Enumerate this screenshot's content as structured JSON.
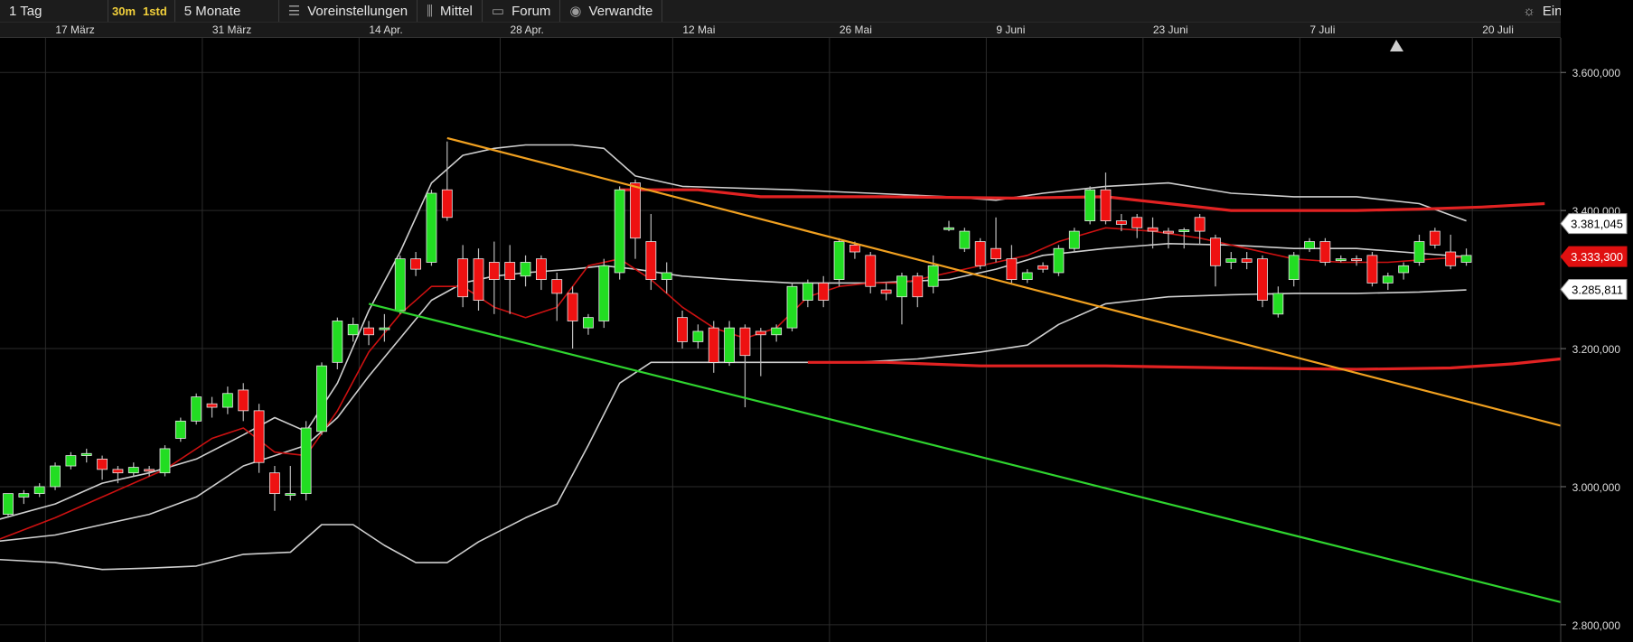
{
  "toolbar": {
    "period": "1 Tag",
    "interval_30m": "30m",
    "interval_1std": "1std",
    "range": "5 Monate",
    "presets": "Voreinstellungen",
    "indicator": "Mittel",
    "forum": "Forum",
    "related": "Verwandte",
    "settings": "Einstellungen"
  },
  "icons": {
    "presets": "sliders-icon",
    "indicator": "candlestick-icon",
    "forum": "speech-bubble-icon",
    "related": "eye-icon",
    "settings": "sun-gear-icon"
  },
  "chart_data": {
    "type": "candlestick",
    "x_axis": {
      "labels": [
        "17 März",
        "31 März",
        "14 Apr.",
        "28 Apr.",
        "12 Mai",
        "26 Mai",
        "9 Juni",
        "23 Juni",
        "7 Juli",
        "20 Juli"
      ],
      "label_index": [
        1,
        11,
        21,
        30,
        41,
        51,
        61,
        71,
        81,
        92
      ]
    },
    "y_axis": {
      "range": [
        2775000,
        3650000
      ],
      "ticks": [
        2800000,
        3000000,
        3200000,
        3400000,
        3600000
      ],
      "tick_labels": [
        "2.800,000",
        "3.000,000",
        "3.200,000",
        "3.400,000",
        "3.600,000"
      ]
    },
    "price_labels": [
      {
        "value": 3381045,
        "text": "3.381,045",
        "style": "white"
      },
      {
        "value": 3333300,
        "text": "3.333,300",
        "style": "red"
      },
      {
        "value": 3285811,
        "text": "3.285,811",
        "style": "white"
      }
    ],
    "colors": {
      "up": "#22dd22",
      "down": "#ee1111",
      "grid": "#2b2b2b",
      "bands": "#cfcfcf",
      "ma": "#cc1111",
      "channel": "#e22222",
      "resistance": "#f0a020",
      "support": "#2fd42f"
    },
    "candles": [
      [
        2960000,
        2990000,
        2955000,
        2990000
      ],
      [
        2985000,
        2990000,
        2975000,
        2995000
      ],
      [
        2990000,
        3000000,
        2985000,
        3005000
      ],
      [
        3000000,
        3030000,
        2995000,
        3035000
      ],
      [
        3030000,
        3045000,
        3025000,
        3050000
      ],
      [
        3045000,
        3048000,
        3035000,
        3055000
      ],
      [
        3040000,
        3025000,
        3010000,
        3045000
      ],
      [
        3025000,
        3020000,
        3005000,
        3030000
      ],
      [
        3020000,
        3028000,
        3015000,
        3035000
      ],
      [
        3025000,
        3024000,
        3015000,
        3030000
      ],
      [
        3020000,
        3055000,
        3015000,
        3060000
      ],
      [
        3070000,
        3095000,
        3065000,
        3100000
      ],
      [
        3095000,
        3130000,
        3090000,
        3135000
      ],
      [
        3120000,
        3115000,
        3100000,
        3130000
      ],
      [
        3115000,
        3135000,
        3105000,
        3145000
      ],
      [
        3140000,
        3110000,
        3095000,
        3150000
      ],
      [
        3110000,
        3035000,
        3020000,
        3120000
      ],
      [
        3020000,
        2990000,
        2965000,
        3030000
      ],
      [
        2990000,
        2990000,
        2980000,
        3030000
      ],
      [
        2990000,
        3085000,
        2980000,
        3095000
      ],
      [
        3080000,
        3175000,
        3075000,
        3180000
      ],
      [
        3180000,
        3240000,
        3170000,
        3245000
      ],
      [
        3220000,
        3235000,
        3210000,
        3245000
      ],
      [
        3230000,
        3220000,
        3205000,
        3240000
      ],
      [
        3230000,
        3230000,
        3210000,
        3250000
      ],
      [
        3255000,
        3330000,
        3250000,
        3335000
      ],
      [
        3330000,
        3315000,
        3305000,
        3340000
      ],
      [
        3325000,
        3425000,
        3320000,
        3430000
      ],
      [
        3430000,
        3390000,
        3385000,
        3500000
      ],
      [
        3330000,
        3275000,
        3260000,
        3350000
      ],
      [
        3330000,
        3270000,
        3255000,
        3345000
      ],
      [
        3325000,
        3300000,
        3250000,
        3355000
      ],
      [
        3325000,
        3300000,
        3250000,
        3350000
      ],
      [
        3305000,
        3325000,
        3290000,
        3335000
      ],
      [
        3330000,
        3300000,
        3285000,
        3335000
      ],
      [
        3300000,
        3280000,
        3240000,
        3310000
      ],
      [
        3280000,
        3240000,
        3200000,
        3290000
      ],
      [
        3230000,
        3245000,
        3220000,
        3250000
      ],
      [
        3240000,
        3320000,
        3230000,
        3330000
      ],
      [
        3310000,
        3430000,
        3300000,
        3435000
      ],
      [
        3440000,
        3360000,
        3330000,
        3445000
      ],
      [
        3355000,
        3300000,
        3285000,
        3395000
      ],
      [
        3300000,
        3310000,
        3280000,
        3325000
      ],
      [
        3245000,
        3210000,
        3200000,
        3255000
      ],
      [
        3210000,
        3225000,
        3200000,
        3235000
      ],
      [
        3230000,
        3180000,
        3165000,
        3240000
      ],
      [
        3180000,
        3230000,
        3175000,
        3240000
      ],
      [
        3230000,
        3190000,
        3115000,
        3235000
      ],
      [
        3225000,
        3220000,
        3160000,
        3230000
      ],
      [
        3220000,
        3230000,
        3210000,
        3235000
      ],
      [
        3230000,
        3290000,
        3225000,
        3295000
      ],
      [
        3270000,
        3295000,
        3260000,
        3300000
      ],
      [
        3295000,
        3270000,
        3260000,
        3305000
      ],
      [
        3300000,
        3355000,
        3290000,
        3360000
      ],
      [
        3350000,
        3340000,
        3330000,
        3355000
      ],
      [
        3335000,
        3290000,
        3280000,
        3340000
      ],
      [
        3285000,
        3280000,
        3270000,
        3295000
      ],
      [
        3275000,
        3305000,
        3235000,
        3310000
      ],
      [
        3305000,
        3275000,
        3260000,
        3310000
      ],
      [
        3290000,
        3320000,
        3280000,
        3335000
      ],
      [
        3375000,
        3375000,
        3370000,
        3385000
      ],
      [
        3345000,
        3370000,
        3340000,
        3375000
      ],
      [
        3355000,
        3320000,
        3315000,
        3360000
      ],
      [
        3345000,
        3330000,
        3325000,
        3390000
      ],
      [
        3330000,
        3300000,
        3295000,
        3350000
      ],
      [
        3300000,
        3310000,
        3295000,
        3315000
      ],
      [
        3320000,
        3315000,
        3310000,
        3325000
      ],
      [
        3310000,
        3345000,
        3305000,
        3350000
      ],
      [
        3345000,
        3370000,
        3340000,
        3375000
      ],
      [
        3385000,
        3430000,
        3380000,
        3435000
      ],
      [
        3430000,
        3385000,
        3380000,
        3455000
      ],
      [
        3385000,
        3380000,
        3370000,
        3395000
      ],
      [
        3390000,
        3375000,
        3360000,
        3395000
      ],
      [
        3375000,
        3370000,
        3345000,
        3390000
      ],
      [
        3370000,
        3368000,
        3345000,
        3375000
      ],
      [
        3370000,
        3372000,
        3345000,
        3375000
      ],
      [
        3390000,
        3370000,
        3350000,
        3395000
      ],
      [
        3360000,
        3320000,
        3290000,
        3365000
      ],
      [
        3325000,
        3330000,
        3315000,
        3340000
      ],
      [
        3330000,
        3325000,
        3315000,
        3340000
      ],
      [
        3330000,
        3270000,
        3260000,
        3335000
      ],
      [
        3250000,
        3280000,
        3245000,
        3290000
      ],
      [
        3300000,
        3335000,
        3290000,
        3340000
      ],
      [
        3345000,
        3355000,
        3340000,
        3360000
      ],
      [
        3355000,
        3325000,
        3320000,
        3360000
      ],
      [
        3330000,
        3330000,
        3325000,
        3335000
      ],
      [
        3330000,
        3328000,
        3320000,
        3335000
      ],
      [
        3335000,
        3295000,
        3290000,
        3340000
      ],
      [
        3295000,
        3305000,
        3285000,
        3310000
      ],
      [
        3310000,
        3320000,
        3300000,
        3325000
      ],
      [
        3325000,
        3355000,
        3320000,
        3365000
      ],
      [
        3370000,
        3350000,
        3345000,
        3375000
      ],
      [
        3340000,
        3320000,
        3315000,
        3365000
      ],
      [
        3325000,
        3335000,
        3320000,
        3345000
      ]
    ],
    "bollinger_upper": [
      [
        -1,
        2950000
      ],
      [
        3,
        2975000
      ],
      [
        6,
        3005000
      ],
      [
        9,
        3020000
      ],
      [
        12,
        3040000
      ],
      [
        15,
        3075000
      ],
      [
        17,
        3100000
      ],
      [
        19,
        3080000
      ],
      [
        21,
        3150000
      ],
      [
        23,
        3255000
      ],
      [
        25,
        3340000
      ],
      [
        27,
        3440000
      ],
      [
        29,
        3480000
      ],
      [
        31,
        3490000
      ],
      [
        33,
        3495000
      ],
      [
        36,
        3495000
      ],
      [
        38,
        3490000
      ],
      [
        40,
        3450000
      ],
      [
        43,
        3435000
      ],
      [
        50,
        3430000
      ],
      [
        55,
        3425000
      ],
      [
        60,
        3420000
      ],
      [
        63,
        3415000
      ],
      [
        66,
        3425000
      ],
      [
        70,
        3435000
      ],
      [
        74,
        3440000
      ],
      [
        78,
        3425000
      ],
      [
        82,
        3420000
      ],
      [
        86,
        3420000
      ],
      [
        90,
        3410000
      ],
      [
        93,
        3385000
      ]
    ],
    "bollinger_lower": [
      [
        -1,
        2895000
      ],
      [
        3,
        2890000
      ],
      [
        6,
        2880000
      ],
      [
        9,
        2882000
      ],
      [
        12,
        2885000
      ],
      [
        15,
        2902000
      ],
      [
        18,
        2905000
      ],
      [
        20,
        2945000
      ],
      [
        22,
        2945000
      ],
      [
        24,
        2915000
      ],
      [
        26,
        2890000
      ],
      [
        28,
        2890000
      ],
      [
        30,
        2920000
      ],
      [
        33,
        2955000
      ],
      [
        35,
        2975000
      ],
      [
        37,
        3060000
      ],
      [
        39,
        3150000
      ],
      [
        41,
        3180000
      ],
      [
        46,
        3180000
      ],
      [
        54,
        3180000
      ],
      [
        58,
        3185000
      ],
      [
        62,
        3195000
      ],
      [
        65,
        3205000
      ],
      [
        67,
        3235000
      ],
      [
        70,
        3265000
      ],
      [
        74,
        3275000
      ],
      [
        78,
        3278000
      ],
      [
        82,
        3280000
      ],
      [
        86,
        3280000
      ],
      [
        90,
        3282000
      ],
      [
        93,
        3285000
      ]
    ],
    "bollinger_mid": [
      [
        -1,
        2920000
      ],
      [
        3,
        2930000
      ],
      [
        6,
        2945000
      ],
      [
        9,
        2960000
      ],
      [
        12,
        2985000
      ],
      [
        15,
        3030000
      ],
      [
        17,
        3045000
      ],
      [
        19,
        3060000
      ],
      [
        21,
        3100000
      ],
      [
        23,
        3160000
      ],
      [
        25,
        3215000
      ],
      [
        27,
        3270000
      ],
      [
        29,
        3295000
      ],
      [
        31,
        3305000
      ],
      [
        33,
        3310000
      ],
      [
        36,
        3315000
      ],
      [
        38,
        3320000
      ],
      [
        40,
        3315000
      ],
      [
        43,
        3305000
      ],
      [
        46,
        3300000
      ],
      [
        50,
        3295000
      ],
      [
        55,
        3295000
      ],
      [
        60,
        3300000
      ],
      [
        63,
        3315000
      ],
      [
        66,
        3335000
      ],
      [
        70,
        3345000
      ],
      [
        74,
        3352000
      ],
      [
        78,
        3350000
      ],
      [
        82,
        3345000
      ],
      [
        86,
        3345000
      ],
      [
        90,
        3338000
      ],
      [
        93,
        3333000
      ]
    ],
    "moving_average": [
      [
        -1,
        2920000
      ],
      [
        3,
        2955000
      ],
      [
        6,
        2985000
      ],
      [
        8,
        3005000
      ],
      [
        10,
        3025000
      ],
      [
        13,
        3070000
      ],
      [
        15,
        3085000
      ],
      [
        17,
        3050000
      ],
      [
        19,
        3045000
      ],
      [
        21,
        3110000
      ],
      [
        23,
        3195000
      ],
      [
        25,
        3250000
      ],
      [
        27,
        3290000
      ],
      [
        29,
        3290000
      ],
      [
        31,
        3260000
      ],
      [
        33,
        3245000
      ],
      [
        35,
        3260000
      ],
      [
        37,
        3320000
      ],
      [
        39,
        3330000
      ],
      [
        41,
        3300000
      ],
      [
        43,
        3260000
      ],
      [
        45,
        3230000
      ],
      [
        47,
        3215000
      ],
      [
        49,
        3230000
      ],
      [
        51,
        3275000
      ],
      [
        53,
        3290000
      ],
      [
        55,
        3295000
      ],
      [
        57,
        3295000
      ],
      [
        59,
        3305000
      ],
      [
        61,
        3315000
      ],
      [
        63,
        3325000
      ],
      [
        65,
        3335000
      ],
      [
        67,
        3355000
      ],
      [
        70,
        3375000
      ],
      [
        73,
        3370000
      ],
      [
        76,
        3360000
      ],
      [
        79,
        3345000
      ],
      [
        82,
        3330000
      ],
      [
        85,
        3325000
      ],
      [
        88,
        3325000
      ],
      [
        91,
        3330000
      ],
      [
        93,
        3333000
      ]
    ],
    "channel_upper": [
      [
        39,
        3430000
      ],
      [
        44,
        3430000
      ],
      [
        48,
        3420000
      ],
      [
        56,
        3420000
      ],
      [
        64,
        3418000
      ],
      [
        70,
        3420000
      ],
      [
        74,
        3410000
      ],
      [
        78,
        3400000
      ],
      [
        86,
        3400000
      ],
      [
        90,
        3402000
      ],
      [
        94,
        3405000
      ],
      [
        98,
        3410000
      ]
    ],
    "channel_lower": [
      [
        51,
        3180000
      ],
      [
        56,
        3180000
      ],
      [
        62,
        3175000
      ],
      [
        70,
        3175000
      ],
      [
        78,
        3172000
      ],
      [
        86,
        3170000
      ],
      [
        92,
        3172000
      ],
      [
        96,
        3178000
      ],
      [
        99,
        3185000
      ]
    ],
    "resistance_line": [
      [
        28,
        3505000
      ],
      [
        103,
        3065000
      ]
    ],
    "support_line": [
      [
        23,
        3265000
      ],
      [
        103,
        2810000
      ]
    ]
  }
}
